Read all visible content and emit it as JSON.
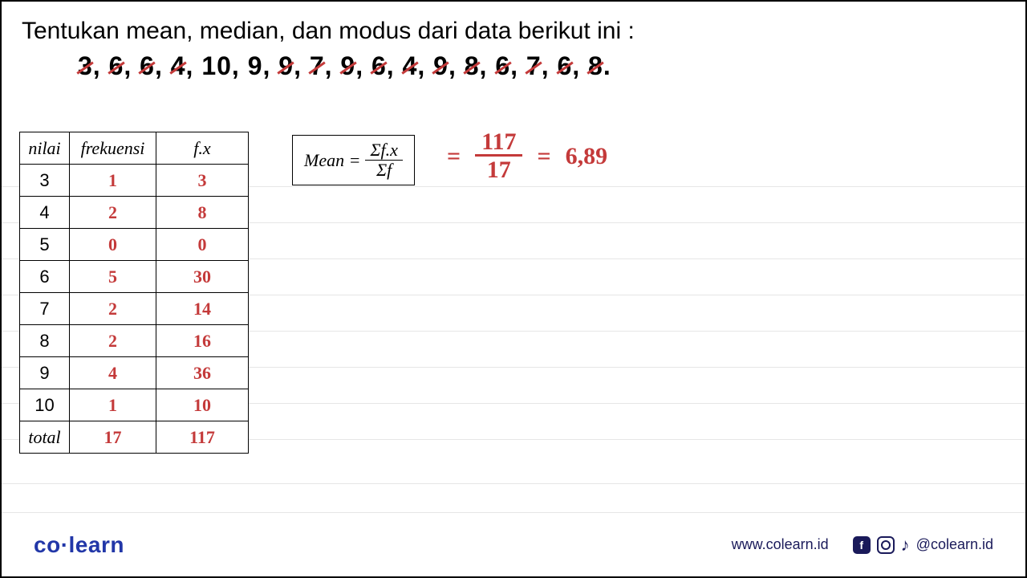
{
  "question": "Tentukan mean, median, dan modus dari data berikut ini :",
  "dataset_values": [
    "3",
    "6",
    "6",
    "4",
    "10",
    "9",
    "9",
    "7",
    "9",
    "6",
    "4",
    "9",
    "8",
    "6",
    "7",
    "6",
    "8"
  ],
  "dataset_slashed": [
    true,
    true,
    true,
    true,
    false,
    false,
    true,
    true,
    true,
    true,
    true,
    true,
    true,
    true,
    true,
    true,
    true
  ],
  "table": {
    "headers": {
      "nilai": "nilai",
      "frekuensi": "frekuensi",
      "fx": "f.x"
    },
    "rows": [
      {
        "nilai": "3",
        "freq": "1",
        "fx": "3"
      },
      {
        "nilai": "4",
        "freq": "2",
        "fx": "8"
      },
      {
        "nilai": "5",
        "freq": "0",
        "fx": "0"
      },
      {
        "nilai": "6",
        "freq": "5",
        "fx": "30"
      },
      {
        "nilai": "7",
        "freq": "2",
        "fx": "14"
      },
      {
        "nilai": "8",
        "freq": "2",
        "fx": "16"
      },
      {
        "nilai": "9",
        "freq": "4",
        "fx": "36"
      },
      {
        "nilai": "10",
        "freq": "1",
        "fx": "10"
      }
    ],
    "total_label": "total",
    "total_freq": "17",
    "total_fx": "117"
  },
  "formula": {
    "lhs": "Mean =",
    "num": "Σf.x",
    "den": "Σf"
  },
  "calc": {
    "eq1": "=",
    "num": "117",
    "den": "17",
    "eq2": "=",
    "result": "6,89"
  },
  "footer": {
    "logo_a": "co",
    "logo_dot": "·",
    "logo_b": "learn",
    "site": "www.colearn.id",
    "handle": "@colearn.id"
  },
  "chart_data": {
    "type": "table",
    "title": "Frequency distribution for mean calculation",
    "columns": [
      "nilai",
      "frekuensi",
      "f.x"
    ],
    "rows": [
      [
        3,
        1,
        3
      ],
      [
        4,
        2,
        8
      ],
      [
        5,
        0,
        0
      ],
      [
        6,
        5,
        30
      ],
      [
        7,
        2,
        14
      ],
      [
        8,
        2,
        16
      ],
      [
        9,
        4,
        36
      ],
      [
        10,
        1,
        10
      ]
    ],
    "totals": {
      "frekuensi": 17,
      "f.x": 117
    },
    "mean": 6.89
  }
}
